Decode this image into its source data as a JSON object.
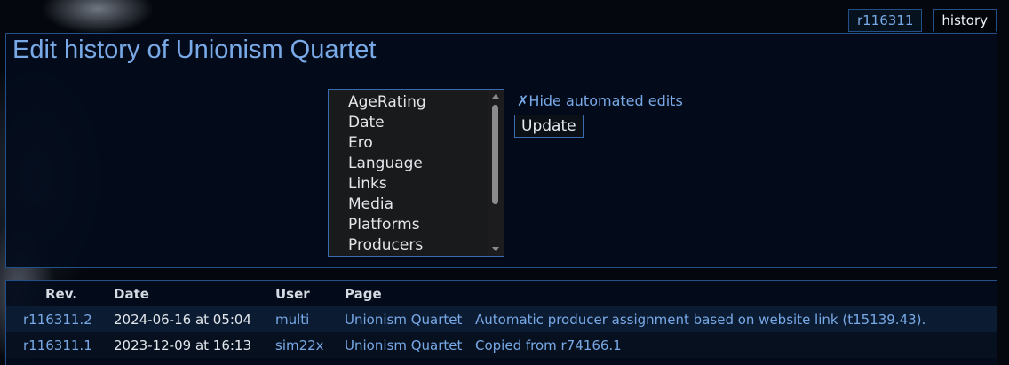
{
  "tabs": [
    {
      "label": "r116311"
    },
    {
      "label": "history"
    }
  ],
  "title": "Edit history of Unionism Quartet",
  "filter": {
    "options": [
      "AgeRating",
      "Date",
      "Ero",
      "Language",
      "Links",
      "Media",
      "Platforms",
      "Producers"
    ],
    "hide_automated": "Hide automated edits",
    "hide_icon_glyph": "✗",
    "update_label": "Update"
  },
  "table": {
    "headers": {
      "rev": "Rev.",
      "date": "Date",
      "user": "User",
      "page": "Page"
    },
    "rows": [
      {
        "rev": "r116311.2",
        "date": "2024-06-16 at 05:04",
        "user": "multi",
        "page": "Unionism Quartet",
        "summary": "Automatic producer assignment based on website link (t15139.43)."
      },
      {
        "rev": "r116311.1",
        "date": "2023-12-09 at 16:13",
        "user": "sim22x",
        "page": "Unionism Quartet",
        "summary": "Copied from r74166.1"
      }
    ]
  }
}
